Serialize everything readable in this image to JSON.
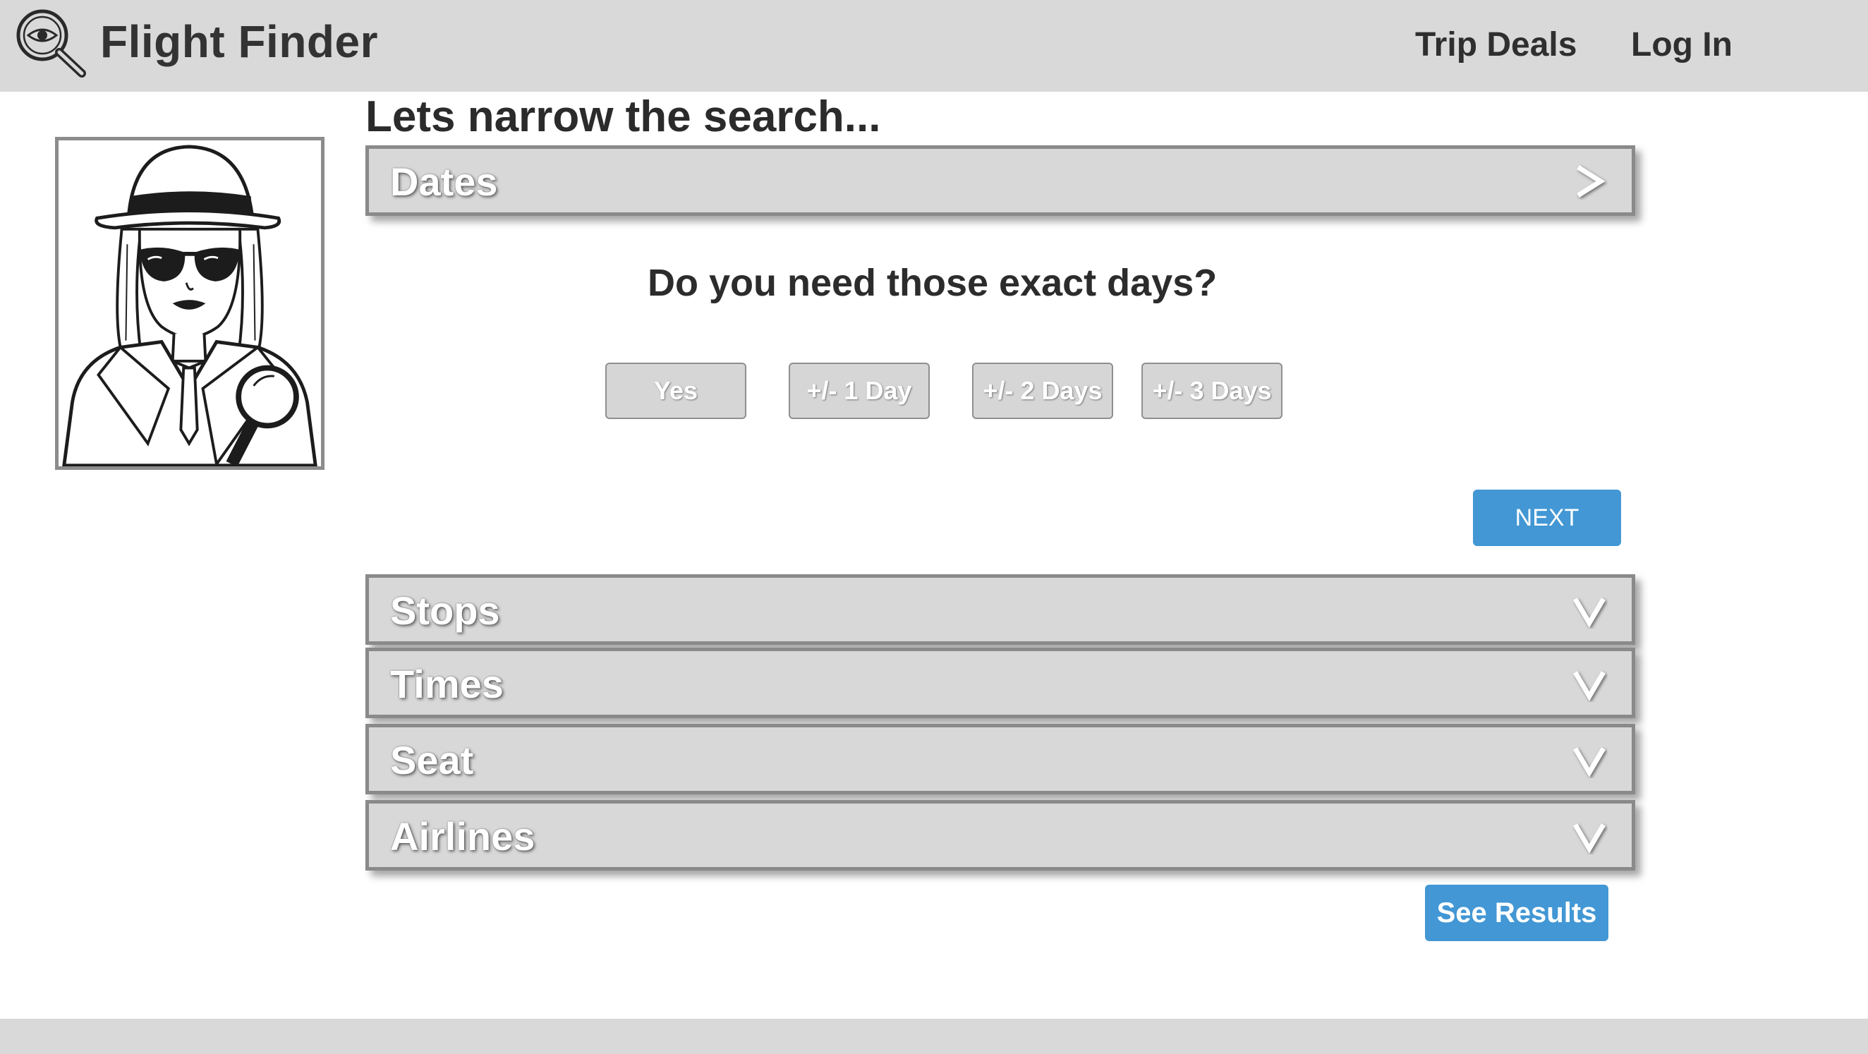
{
  "header": {
    "brand": "Flight Finder",
    "nav": {
      "trip_deals": "Trip Deals",
      "log_in": "Log In"
    },
    "icon": "magnifier-eye-icon"
  },
  "main": {
    "title": "Lets narrow the search...",
    "sections": {
      "dates": {
        "label": "Dates",
        "icon": "chevron-right-icon"
      },
      "stops": {
        "label": "Stops",
        "icon": "chevron-down-icon"
      },
      "times": {
        "label": "Times",
        "icon": "chevron-down-icon"
      },
      "seat": {
        "label": "Seat",
        "icon": "chevron-down-icon"
      },
      "airlines": {
        "label": "Airlines",
        "icon": "chevron-down-icon"
      }
    },
    "dates_panel": {
      "question": "Do you need those exact days?",
      "options": [
        "Yes",
        "+/- 1 Day",
        "+/- 2 Days",
        "+/- 3 Days"
      ],
      "next_label": "NEXT"
    },
    "see_results_label": "See Results"
  },
  "colors": {
    "header_bg": "#d9d9d9",
    "bar_bg": "#d8d8d8",
    "accent_blue": "#4297d4"
  }
}
